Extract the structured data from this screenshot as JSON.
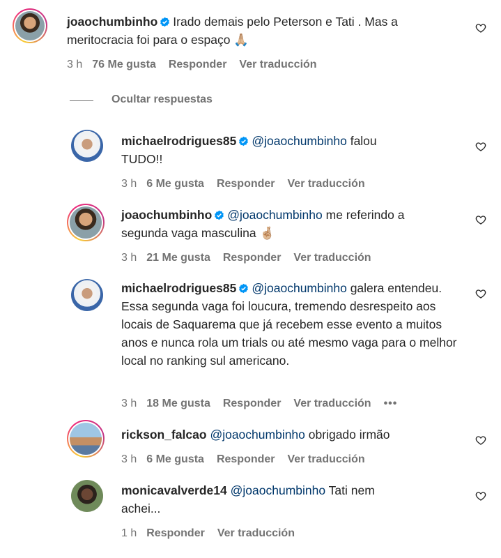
{
  "hide_replies_label": "Ocultar respuestas",
  "labels": {
    "reply": "Responder",
    "translate": "Ver traducción"
  },
  "comments": [
    {
      "username": "joaochumbinho",
      "verified": true,
      "mention": "",
      "text_line1": "Irado demais pelo Peterson e Tati . Mas a",
      "text_rest": "meritocracia foi para o espaço 🙏🏼",
      "time": "3 h",
      "likes": "76 Me gusta"
    },
    {
      "username": "michaelrodrigues85",
      "verified": true,
      "mention": "@joaochumbinho",
      "text_line1": "falou",
      "text_rest": "TUDO!!",
      "time": "3 h",
      "likes": "6 Me gusta"
    },
    {
      "username": "joaochumbinho",
      "verified": true,
      "mention": "@joaochumbinho",
      "text_line1": "me referindo a",
      "text_rest": "segunda vaga masculina 🤞🏼",
      "time": "3 h",
      "likes": "21 Me gusta"
    },
    {
      "username": "michaelrodrigues85",
      "verified": true,
      "mention": "@joaochumbinho",
      "text_line1": "galera",
      "text_rest": "entendeu. Essa segunda vaga foi loucura, tremendo desrespeito aos locais de Saquarema que já recebem esse evento a muitos anos e nunca rola um trials ou até mesmo vaga para o melhor local no ranking sul americano.",
      "time": "3 h",
      "likes": "18 Me gusta",
      "more": "•••"
    },
    {
      "username": "rickson_falcao",
      "verified": false,
      "mention": "@joaochumbinho",
      "text_line1": "obrigado irmão",
      "text_rest": "",
      "time": "3 h",
      "likes": "6 Me gusta"
    },
    {
      "username": "monicavalverde14",
      "verified": false,
      "mention": "@joaochumbinho",
      "text_line1": "Tati nem",
      "text_rest": "achei...",
      "time": "1 h",
      "likes": ""
    }
  ]
}
